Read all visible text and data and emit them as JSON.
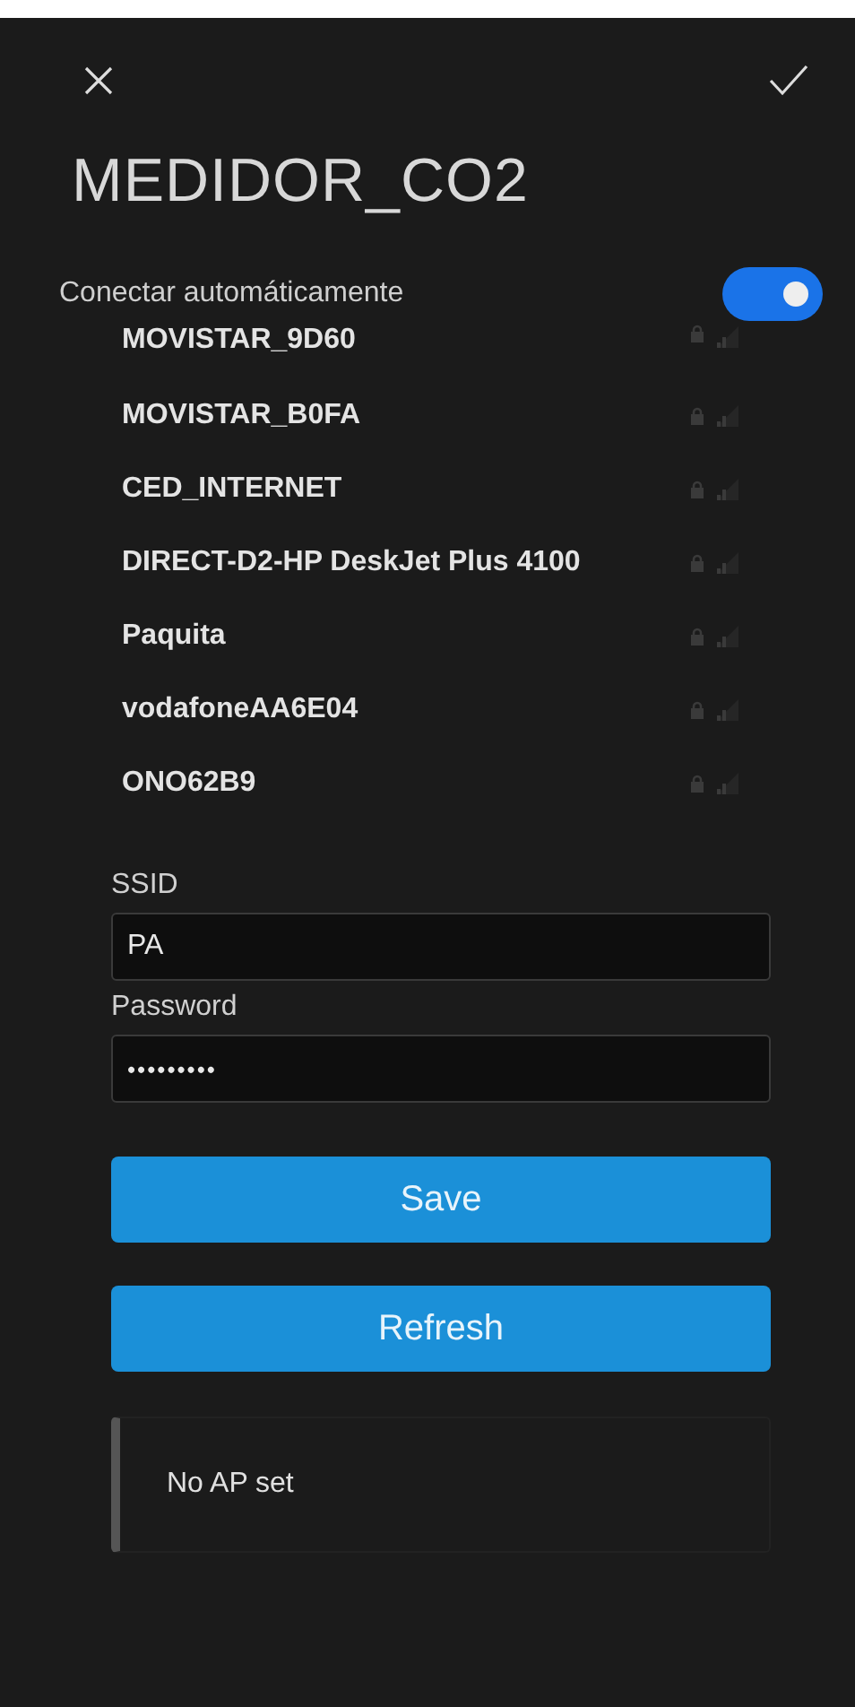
{
  "title": "MEDIDOR_CO2",
  "auto_connect": {
    "label": "Conectar automáticamente",
    "on": true
  },
  "networks": [
    {
      "ssid": "MOVISTAR_9D60"
    },
    {
      "ssid": "MOVISTAR_B0FA"
    },
    {
      "ssid": "CED_INTERNET"
    },
    {
      "ssid": "DIRECT-D2-HP DeskJet Plus 4100"
    },
    {
      "ssid": "Paquita"
    },
    {
      "ssid": "vodafoneAA6E04"
    },
    {
      "ssid": "ONO62B9"
    }
  ],
  "ssid_field": {
    "label": "SSID",
    "value": "PA"
  },
  "password_field": {
    "label": "Password",
    "value": "•••••••••"
  },
  "buttons": [
    "Save",
    "Refresh"
  ],
  "status": "No AP set"
}
